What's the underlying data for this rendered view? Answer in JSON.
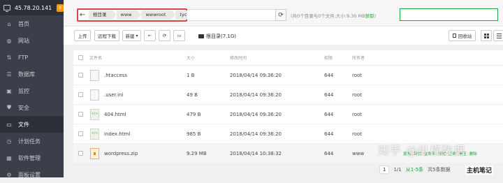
{
  "sidebar": {
    "ip": "45.78.20.141",
    "badge": "0",
    "items": [
      {
        "label": "首页",
        "icon": "home-icon",
        "glyph": "⌂",
        "active": false
      },
      {
        "label": "网站",
        "icon": "globe-icon",
        "glyph": "◍",
        "active": false
      },
      {
        "label": "FTP",
        "icon": "ftp-icon",
        "glyph": "⇅",
        "active": false
      },
      {
        "label": "数据库",
        "icon": "database-icon",
        "glyph": "☰",
        "active": false
      },
      {
        "label": "监控",
        "icon": "monitor-icon",
        "glyph": "▣",
        "active": false
      },
      {
        "label": "安全",
        "icon": "shield-icon",
        "glyph": "⛊",
        "active": false
      },
      {
        "label": "文件",
        "icon": "folder-icon",
        "glyph": "▭",
        "active": true
      },
      {
        "label": "计划任务",
        "icon": "clock-icon",
        "glyph": "◷",
        "active": false
      },
      {
        "label": "软件管理",
        "icon": "apps-icon",
        "glyph": "▦",
        "active": false
      },
      {
        "label": "面板设置",
        "icon": "gear-icon",
        "glyph": "⚙",
        "active": false
      }
    ]
  },
  "topbar": {
    "breadcrumb": [
      "根目录",
      "www",
      "wwwroot",
      "tycyt.com"
    ],
    "info_text": "(共0个目录与0个文件,大小:9.30 MB",
    "info_link": "获取",
    "info_close": ")"
  },
  "toolbar": {
    "upload": "上传",
    "remote_download": "远程下载",
    "new": "新建",
    "new_caret": "▾",
    "disk": "根目录(7.1G)",
    "recycle": "回收站"
  },
  "table": {
    "headers": [
      "文件名",
      "大小",
      "修改时间",
      "权限",
      "所有者"
    ],
    "rows": [
      {
        "name": ".htaccess",
        "size": "1 B",
        "time": "2018/04/14 09:36:20",
        "perm": "644",
        "owner": "root",
        "type": "plain"
      },
      {
        "name": ".user.ini",
        "size": "49 B",
        "time": "2018/04/14 09:36:20",
        "perm": "644",
        "owner": "root",
        "type": "plain"
      },
      {
        "name": "404.html",
        "size": "479 B",
        "time": "2018/04/14 09:36:20",
        "perm": "644",
        "owner": "root",
        "type": "html"
      },
      {
        "name": "index.html",
        "size": "985 B",
        "time": "2018/04/14 09:36:20",
        "perm": "644",
        "owner": "root",
        "type": "html"
      },
      {
        "name": "wordpress.zip",
        "size": "9.29 MB",
        "time": "2018/04/14 10:38:32",
        "perm": "644",
        "owner": "www",
        "type": "zip"
      }
    ],
    "row_actions": [
      "复制",
      "剪切",
      "重命名",
      "权限",
      "压缩",
      "解压",
      "删除"
    ]
  },
  "pager": {
    "page": "1",
    "total_pages": "1/1",
    "range": "从1-5条",
    "total": "共5条数据"
  },
  "watermark": {
    "main": "知乎 @纵横数据",
    "secondary": "主机笔记"
  }
}
